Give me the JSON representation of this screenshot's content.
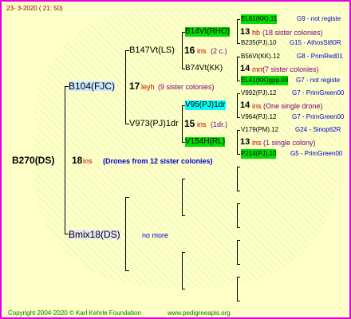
{
  "header": {
    "date": "23-  3-2020 ( 21: 50)"
  },
  "footer": {
    "copyright": "Copyright 2004-2020 © Karl Kehrle Foundation",
    "url": "www.pedigreeapis.org"
  },
  "root": {
    "name": "B270(DS)",
    "num": "18",
    "ins": "ins",
    "note": "(Drones from 12 sister colonies)"
  },
  "mother": {
    "name": "B104(FJC)",
    "num": "17",
    "tag": "leyh",
    "note": "(9 sister colonies)"
  },
  "father_mix": {
    "name": "Bmix18(DS)",
    "note": "no more"
  },
  "gm_queen": {
    "name": "B147Vt(LS)",
    "num": "16",
    "ins": "ins",
    "note": "(2 c.)"
  },
  "gm_drone": {
    "name": "V973(PJ)1dr",
    "num": "15",
    "ins": "ins",
    "note": "(1dr.)"
  },
  "ggm_queen": {
    "name": "B14Vt(RHO)",
    "num": "13",
    "tag": "hb",
    "note": "(18 sister colonies)"
  },
  "ggm_drone": {
    "name": "B74Vt(KK)",
    "num": "14",
    "tag": "mm",
    "note": "(7 sister colonies)"
  },
  "ggd_queen": {
    "name": "V95(PJ)1dr",
    "num": "14",
    "ins": "ins",
    "note": "(One single drone)"
  },
  "ggd_drone": {
    "name": "V154H(RL)",
    "num": "13",
    "ins": "ins",
    "note": "(1 single colony)"
  },
  "gen4": [
    {
      "name": "EL61(KK).11",
      "tail": "G9 - not registe"
    },
    {
      "name": "B235(PJ).10",
      "tail": "G15 - AthosSt80R"
    },
    {
      "name": "B56Vt(KK).12",
      "tail": "G8 - PrimRed01"
    },
    {
      "name": "EL41(KK)gpp.09",
      "tail": "G7 - not registe"
    },
    {
      "name": "V992(PJ).12",
      "tail": "G7 - PrimGreen00"
    },
    {
      "name": "V964(PJ).12",
      "tail": "G7 - PrimGreen00"
    },
    {
      "name": "V179(PM).12",
      "tail": "G24 - Sinop62R"
    },
    {
      "name": "P214(PJ).10",
      "tail": "G5 - PrimGreen00"
    }
  ]
}
